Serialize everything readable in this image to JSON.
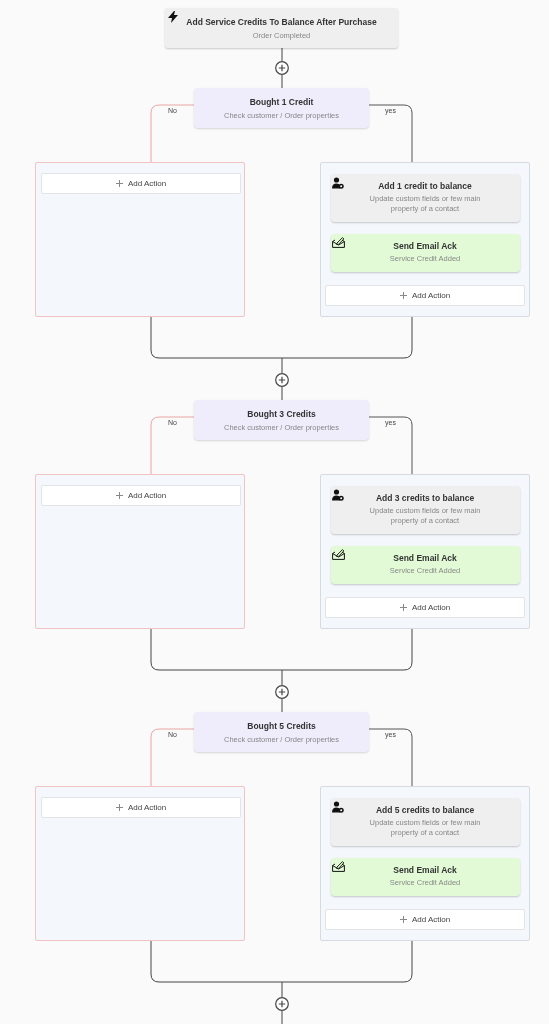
{
  "trigger": {
    "title": "Add Service Credits To Balance After Purchase",
    "subtitle": "Order Completed"
  },
  "sections": [
    {
      "condition": {
        "title": "Bought 1 Credit",
        "subtitle": "Check customer / Order properties"
      },
      "no_label": "No",
      "yes_label": "yes",
      "no_branch": {
        "add_action": "Add Action"
      },
      "yes_branch": {
        "actions": [
          {
            "kind": "contact",
            "title": "Add 1 credit to balance",
            "subtitle": "Update custom fields or few main property of a contact"
          },
          {
            "kind": "email",
            "title": "Send Email Ack",
            "subtitle": "Service Credit Added"
          }
        ],
        "add_action": "Add Action"
      }
    },
    {
      "condition": {
        "title": "Bought 3 Credits",
        "subtitle": "Check customer / Order properties"
      },
      "no_label": "No",
      "yes_label": "yes",
      "no_branch": {
        "add_action": "Add Action"
      },
      "yes_branch": {
        "actions": [
          {
            "kind": "contact",
            "title": "Add 3 credits to balance",
            "subtitle": "Update custom fields or few main property of a contact"
          },
          {
            "kind": "email",
            "title": "Send Email Ack",
            "subtitle": "Service Credit Added"
          }
        ],
        "add_action": "Add Action"
      }
    },
    {
      "condition": {
        "title": "Bought 5 Credits",
        "subtitle": "Check customer / Order properties"
      },
      "no_label": "No",
      "yes_label": "yes",
      "no_branch": {
        "add_action": "Add Action"
      },
      "yes_branch": {
        "actions": [
          {
            "kind": "contact",
            "title": "Add 5 credits to balance",
            "subtitle": "Update custom fields or few main property of a contact"
          },
          {
            "kind": "email",
            "title": "Send Email Ack",
            "subtitle": "Service Credit Added"
          }
        ],
        "add_action": "Add Action"
      }
    }
  ]
}
